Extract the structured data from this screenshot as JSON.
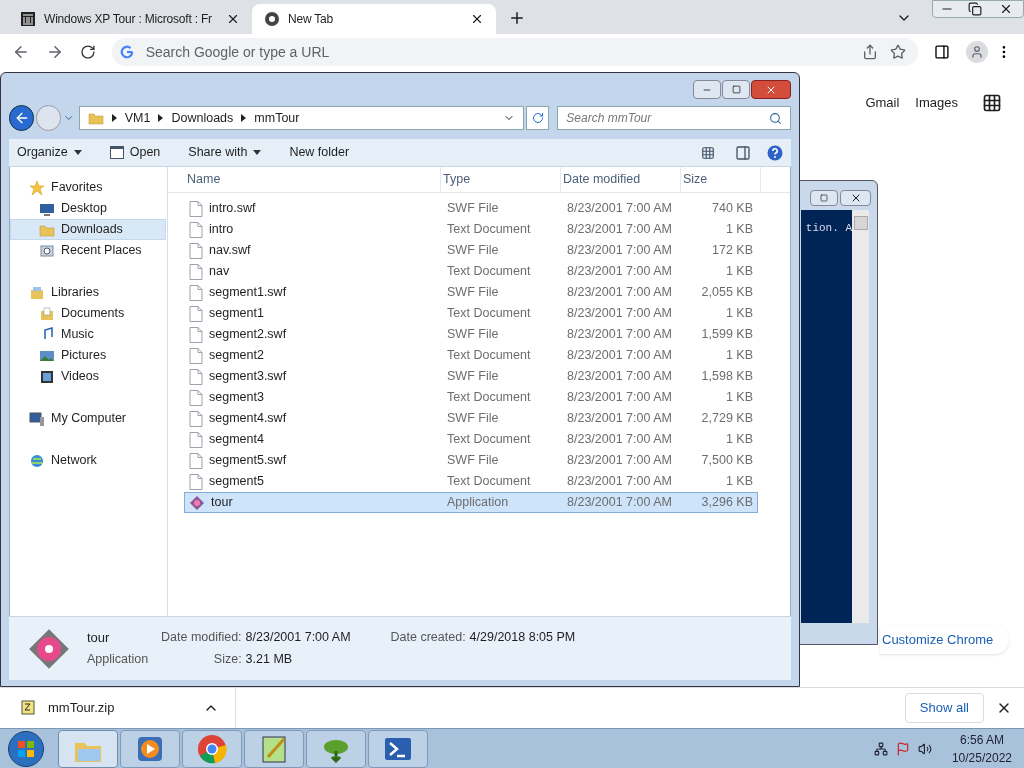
{
  "browser": {
    "tabs": [
      {
        "title": "Windows XP Tour : Microsoft : Fr",
        "kind": "archive",
        "selected": false
      },
      {
        "title": "New Tab",
        "kind": "chrome",
        "selected": true
      }
    ],
    "omnibox": {
      "placeholder": "Search Google or type a URL"
    },
    "links": [
      "Gmail",
      "Images"
    ],
    "customize": "Customize Chrome",
    "download": {
      "file": "mmTour.zip",
      "show_all": "Show all"
    }
  },
  "console": {
    "text": "tion. A"
  },
  "explorer": {
    "breadcrumb": [
      "VM1",
      "Downloads",
      "mmTour"
    ],
    "search": {
      "placeholder": "Search mmTour"
    },
    "toolbar": [
      {
        "label": "Organize",
        "kind": "menu"
      },
      {
        "label": "Open",
        "kind": "open"
      },
      {
        "label": "Share with",
        "kind": "menu"
      },
      {
        "label": "New folder",
        "kind": "plain"
      }
    ],
    "nav": [
      {
        "label": "Favorites",
        "kind": "star",
        "selected": false,
        "children": [
          {
            "label": "Desktop",
            "kind": "desktop",
            "selected": false
          },
          {
            "label": "Downloads",
            "kind": "folder",
            "selected": true
          },
          {
            "label": "Recent Places",
            "kind": "recent",
            "selected": false
          }
        ]
      },
      {
        "label": "Libraries",
        "kind": "library",
        "selected": false,
        "children": [
          {
            "label": "Documents",
            "kind": "documents",
            "selected": false
          },
          {
            "label": "Music",
            "kind": "music",
            "selected": false
          },
          {
            "label": "Pictures",
            "kind": "pictures",
            "selected": false
          },
          {
            "label": "Videos",
            "kind": "videos",
            "selected": false
          }
        ]
      },
      {
        "label": "My Computer",
        "kind": "computer",
        "selected": false
      },
      {
        "label": "Network",
        "kind": "network",
        "selected": false
      }
    ],
    "columns": [
      "Name",
      "Type",
      "Date modified",
      "Size"
    ],
    "files": [
      {
        "name": "intro.swf",
        "type": "SWF File",
        "date": "8/23/2001 7:00 AM",
        "size": "740 KB",
        "kind": "file",
        "selected": false
      },
      {
        "name": "intro",
        "type": "Text Document",
        "date": "8/23/2001 7:00 AM",
        "size": "1 KB",
        "kind": "file",
        "selected": false
      },
      {
        "name": "nav.swf",
        "type": "SWF File",
        "date": "8/23/2001 7:00 AM",
        "size": "172 KB",
        "kind": "file",
        "selected": false
      },
      {
        "name": "nav",
        "type": "Text Document",
        "date": "8/23/2001 7:00 AM",
        "size": "1 KB",
        "kind": "file",
        "selected": false
      },
      {
        "name": "segment1.swf",
        "type": "SWF File",
        "date": "8/23/2001 7:00 AM",
        "size": "2,055 KB",
        "kind": "file",
        "selected": false
      },
      {
        "name": "segment1",
        "type": "Text Document",
        "date": "8/23/2001 7:00 AM",
        "size": "1 KB",
        "kind": "file",
        "selected": false
      },
      {
        "name": "segment2.swf",
        "type": "SWF File",
        "date": "8/23/2001 7:00 AM",
        "size": "1,599 KB",
        "kind": "file",
        "selected": false
      },
      {
        "name": "segment2",
        "type": "Text Document",
        "date": "8/23/2001 7:00 AM",
        "size": "1 KB",
        "kind": "file",
        "selected": false
      },
      {
        "name": "segment3.swf",
        "type": "SWF File",
        "date": "8/23/2001 7:00 AM",
        "size": "1,598 KB",
        "kind": "file",
        "selected": false
      },
      {
        "name": "segment3",
        "type": "Text Document",
        "date": "8/23/2001 7:00 AM",
        "size": "1 KB",
        "kind": "file",
        "selected": false
      },
      {
        "name": "segment4.swf",
        "type": "SWF File",
        "date": "8/23/2001 7:00 AM",
        "size": "2,729 KB",
        "kind": "file",
        "selected": false
      },
      {
        "name": "segment4",
        "type": "Text Document",
        "date": "8/23/2001 7:00 AM",
        "size": "1 KB",
        "kind": "file",
        "selected": false
      },
      {
        "name": "segment5.swf",
        "type": "SWF File",
        "date": "8/23/2001 7:00 AM",
        "size": "7,500 KB",
        "kind": "file",
        "selected": false
      },
      {
        "name": "segment5",
        "type": "Text Document",
        "date": "8/23/2001 7:00 AM",
        "size": "1 KB",
        "kind": "file",
        "selected": false
      },
      {
        "name": "tour",
        "type": "Application",
        "date": "8/23/2001 7:00 AM",
        "size": "3,296 KB",
        "kind": "app",
        "selected": true
      }
    ],
    "details": {
      "name": "tour",
      "type": "Application",
      "fields": [
        {
          "label": "Date modified:",
          "value": "8/23/2001 7:00 AM"
        },
        {
          "label": "Date created:",
          "value": "4/29/2018 8:05 PM"
        },
        {
          "label": "Size:",
          "value": "3.21 MB"
        }
      ]
    }
  },
  "taskbar": {
    "apps": [
      {
        "kind": "explorer",
        "selected": true
      },
      {
        "kind": "media",
        "selected": false
      },
      {
        "kind": "chrome",
        "selected": false
      },
      {
        "kind": "notepad",
        "selected": false
      },
      {
        "kind": "download",
        "selected": false
      },
      {
        "kind": "terminal",
        "selected": false
      }
    ],
    "time": "6:56 AM",
    "date": "10/25/2022"
  }
}
